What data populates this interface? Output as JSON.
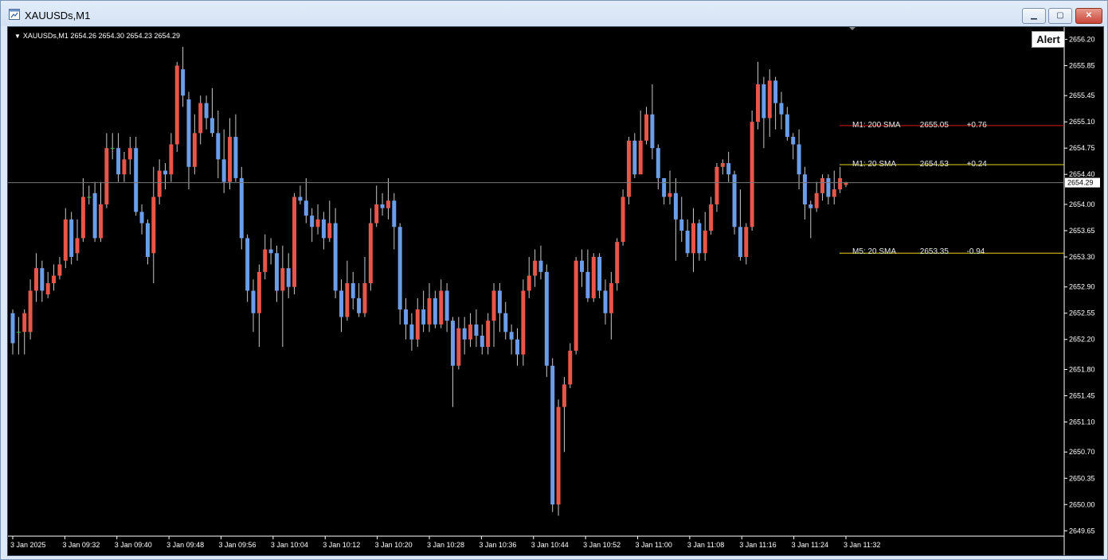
{
  "window": {
    "title": "XAUUSDs,M1",
    "buttons": {
      "minimize": "▁",
      "maximize": "▢",
      "close": "✕"
    }
  },
  "chart": {
    "header": "XAUUSDs,M1  2654.26 2654.30 2654.23 2654.29",
    "alert_label": "Alert",
    "current_price": "2654.29",
    "colors": {
      "background": "#000000",
      "bull": "#e8564a",
      "bear": "#6b9de8",
      "neutral": "#3cc33c",
      "axis_text": "#ffffff",
      "grid_line": "#7a7a7a",
      "sma_m1_200": "#d01c1c",
      "sma_m1_20": "#e3d51e",
      "sma_m5_20": "#e3d51e"
    },
    "sma_lines": [
      {
        "name": "M1: 200  SMA",
        "value": "2655.05",
        "diff": "+0.76",
        "price": 2655.05,
        "color": "#d01c1c"
      },
      {
        "name": "M1: 20  SMA",
        "value": "2654.53",
        "diff": "+0.24",
        "price": 2654.53,
        "color": "#e3d51e"
      },
      {
        "name": "M5: 20  SMA",
        "value": "2653.35",
        "diff": "-0.94",
        "price": 2653.35,
        "color": "#e3d51e"
      }
    ]
  },
  "chart_data": {
    "type": "candlestick",
    "y_ticks": [
      "2656.20",
      "2655.85",
      "2655.45",
      "2655.10",
      "2654.75",
      "2654.40",
      "2654.00",
      "2653.65",
      "2653.30",
      "2652.90",
      "2652.55",
      "2652.20",
      "2651.80",
      "2651.45",
      "2651.10",
      "2650.70",
      "2650.35",
      "2650.00",
      "2649.65"
    ],
    "x_ticks": [
      "3 Jan 2025",
      "3 Jan 09:32",
      "3 Jan 09:40",
      "3 Jan 09:48",
      "3 Jan 09:56",
      "3 Jan 10:04",
      "3 Jan 10:12",
      "3 Jan 10:20",
      "3 Jan 10:28",
      "3 Jan 10:36",
      "3 Jan 10:44",
      "3 Jan 10:52",
      "3 Jan 11:00",
      "3 Jan 11:08",
      "3 Jan 11:16",
      "3 Jan 11:24",
      "3 Jan 11:32"
    ],
    "ylim": [
      2649.6,
      2656.3
    ],
    "candles": [
      [
        2652.55,
        2652.15,
        2652.6,
        2652.0
      ],
      [
        2652.3,
        2652.3,
        2652.5,
        2652.0
      ],
      [
        2652.3,
        2652.55,
        2652.6,
        2652.0
      ],
      [
        2652.3,
        2652.85,
        2653.0,
        2652.2
      ],
      [
        2652.85,
        2653.15,
        2653.35,
        2652.7
      ],
      [
        2653.15,
        2652.85,
        2653.25,
        2652.7
      ],
      [
        2652.8,
        2652.95,
        2653.1,
        2652.75
      ],
      [
        2652.95,
        2653.05,
        2653.2,
        2652.85
      ],
      [
        2653.05,
        2653.2,
        2653.3,
        2653.0
      ],
      [
        2653.25,
        2653.8,
        2653.95,
        2653.15
      ],
      [
        2653.8,
        2653.3,
        2653.9,
        2653.2
      ],
      [
        2653.35,
        2653.55,
        2653.8,
        2653.25
      ],
      [
        2653.55,
        2654.1,
        2654.35,
        2653.5
      ],
      [
        2654.1,
        2654.1,
        2654.25,
        2654.0
      ],
      [
        2654.15,
        2653.55,
        2654.3,
        2653.5
      ],
      [
        2653.55,
        2654.0,
        2654.3,
        2653.5
      ],
      [
        2654.0,
        2654.75,
        2654.95,
        2653.95
      ],
      [
        2654.75,
        2654.75,
        2654.95,
        2654.6
      ],
      [
        2654.75,
        2654.4,
        2654.95,
        2654.3
      ],
      [
        2654.4,
        2654.6,
        2654.7,
        2654.3
      ],
      [
        2654.6,
        2654.75,
        2654.9,
        2654.4
      ],
      [
        2654.75,
        2653.9,
        2654.9,
        2653.85
      ],
      [
        2653.9,
        2653.75,
        2654.0,
        2653.6
      ],
      [
        2653.75,
        2653.3,
        2653.8,
        2653.2
      ],
      [
        2653.35,
        2654.1,
        2654.5,
        2652.95
      ],
      [
        2654.1,
        2654.45,
        2654.6,
        2654.0
      ],
      [
        2654.45,
        2654.4,
        2654.55,
        2654.2
      ],
      [
        2654.4,
        2654.8,
        2654.95,
        2654.3
      ],
      [
        2654.8,
        2655.85,
        2655.9,
        2654.7
      ],
      [
        2655.8,
        2655.45,
        2656.1,
        2655.3
      ],
      [
        2655.4,
        2654.5,
        2655.5,
        2654.2
      ],
      [
        2654.5,
        2654.95,
        2655.2,
        2654.4
      ],
      [
        2654.95,
        2655.35,
        2655.45,
        2654.8
      ],
      [
        2655.35,
        2655.15,
        2655.45,
        2655.0
      ],
      [
        2655.15,
        2654.95,
        2655.55,
        2654.9
      ],
      [
        2654.95,
        2654.6,
        2655.25,
        2654.35
      ],
      [
        2654.6,
        2654.3,
        2655.0,
        2654.15
      ],
      [
        2654.3,
        2654.9,
        2655.15,
        2654.2
      ],
      [
        2654.9,
        2654.35,
        2655.2,
        2654.3
      ],
      [
        2654.35,
        2653.55,
        2654.5,
        2653.4
      ],
      [
        2653.55,
        2652.85,
        2653.6,
        2652.7
      ],
      [
        2652.85,
        2652.55,
        2653.0,
        2652.3
      ],
      [
        2652.55,
        2653.1,
        2653.2,
        2652.1
      ],
      [
        2653.1,
        2653.4,
        2653.6,
        2653.0
      ],
      [
        2653.4,
        2653.35,
        2653.55,
        2653.2
      ],
      [
        2653.35,
        2652.85,
        2653.45,
        2652.7
      ],
      [
        2652.85,
        2653.15,
        2653.45,
        2652.1
      ],
      [
        2653.15,
        2652.9,
        2653.35,
        2652.75
      ],
      [
        2652.9,
        2654.1,
        2654.15,
        2652.8
      ],
      [
        2654.1,
        2654.05,
        2654.25,
        2654.0
      ],
      [
        2654.05,
        2653.85,
        2654.35,
        2653.75
      ],
      [
        2653.85,
        2653.7,
        2653.95,
        2653.5
      ],
      [
        2653.7,
        2653.8,
        2654.0,
        2653.6
      ],
      [
        2653.8,
        2653.55,
        2653.9,
        2653.4
      ],
      [
        2653.55,
        2653.75,
        2654.05,
        2653.5
      ],
      [
        2653.75,
        2652.85,
        2653.95,
        2652.75
      ],
      [
        2652.85,
        2652.5,
        2653.0,
        2652.3
      ],
      [
        2652.5,
        2652.95,
        2653.25,
        2652.45
      ],
      [
        2652.95,
        2652.75,
        2653.1,
        2652.6
      ],
      [
        2652.75,
        2652.55,
        2652.95,
        2652.5
      ],
      [
        2652.55,
        2652.95,
        2653.3,
        2652.5
      ],
      [
        2652.95,
        2653.75,
        2653.95,
        2652.85
      ],
      [
        2653.75,
        2654.0,
        2654.25,
        2653.7
      ],
      [
        2654.0,
        2653.95,
        2654.15,
        2653.85
      ],
      [
        2653.95,
        2654.05,
        2654.35,
        2653.8
      ],
      [
        2654.05,
        2653.7,
        2654.15,
        2653.4
      ],
      [
        2653.7,
        2652.6,
        2653.75,
        2652.4
      ],
      [
        2652.6,
        2652.4,
        2652.75,
        2652.2
      ],
      [
        2652.4,
        2652.2,
        2652.55,
        2652.05
      ],
      [
        2652.2,
        2652.6,
        2652.75,
        2652.1
      ],
      [
        2652.6,
        2652.4,
        2652.85,
        2652.3
      ],
      [
        2652.4,
        2652.75,
        2652.95,
        2652.3
      ],
      [
        2652.75,
        2652.4,
        2652.85,
        2652.35
      ],
      [
        2652.4,
        2652.85,
        2653.0,
        2652.35
      ],
      [
        2652.85,
        2652.45,
        2652.95,
        2652.3
      ],
      [
        2652.45,
        2651.85,
        2652.5,
        2651.3
      ],
      [
        2651.85,
        2652.35,
        2652.5,
        2651.8
      ],
      [
        2652.35,
        2652.2,
        2652.5,
        2652.0
      ],
      [
        2652.2,
        2652.4,
        2652.55,
        2652.1
      ],
      [
        2652.4,
        2652.25,
        2652.6,
        2652.1
      ],
      [
        2652.25,
        2652.1,
        2652.4,
        2652.0
      ],
      [
        2652.1,
        2652.45,
        2652.55,
        2652.0
      ],
      [
        2652.45,
        2652.85,
        2652.95,
        2652.1
      ],
      [
        2652.85,
        2652.55,
        2652.95,
        2652.3
      ],
      [
        2652.55,
        2652.3,
        2652.7,
        2652.2
      ],
      [
        2652.3,
        2652.2,
        2652.4,
        2652.0
      ],
      [
        2652.2,
        2652.0,
        2652.35,
        2651.85
      ],
      [
        2652.0,
        2652.85,
        2653.0,
        2651.85
      ],
      [
        2652.85,
        2653.05,
        2653.3,
        2652.75
      ],
      [
        2653.05,
        2653.25,
        2653.4,
        2652.9
      ],
      [
        2653.25,
        2653.1,
        2653.45,
        2653.0
      ],
      [
        2653.1,
        2651.85,
        2653.2,
        2651.7
      ],
      [
        2651.85,
        2650.0,
        2651.95,
        2649.9
      ],
      [
        2650.0,
        2651.3,
        2651.4,
        2649.85
      ],
      [
        2651.3,
        2651.6,
        2651.7,
        2650.7
      ],
      [
        2651.6,
        2652.05,
        2652.15,
        2651.55
      ],
      [
        2652.05,
        2653.25,
        2653.3,
        2652.0
      ],
      [
        2653.25,
        2653.1,
        2653.4,
        2652.9
      ],
      [
        2653.1,
        2652.75,
        2653.4,
        2652.7
      ],
      [
        2652.75,
        2653.3,
        2653.35,
        2652.7
      ],
      [
        2653.3,
        2652.85,
        2653.35,
        2652.75
      ],
      [
        2652.85,
        2652.55,
        2653.0,
        2652.4
      ],
      [
        2652.55,
        2652.95,
        2653.1,
        2652.2
      ],
      [
        2652.95,
        2653.5,
        2653.55,
        2652.85
      ],
      [
        2653.5,
        2654.1,
        2654.2,
        2653.45
      ],
      [
        2654.1,
        2654.85,
        2654.9,
        2654.0
      ],
      [
        2654.85,
        2654.4,
        2654.95,
        2654.35
      ],
      [
        2654.4,
        2654.85,
        2655.25,
        2654.7
      ],
      [
        2654.85,
        2655.2,
        2655.3,
        2654.8
      ],
      [
        2655.2,
        2654.75,
        2655.6,
        2654.6
      ],
      [
        2654.75,
        2654.35,
        2654.8,
        2654.2
      ],
      [
        2654.35,
        2654.1,
        2654.3,
        2654.0
      ],
      [
        2654.1,
        2654.15,
        2654.45,
        2654.0
      ],
      [
        2654.15,
        2653.8,
        2654.35,
        2653.25
      ],
      [
        2653.8,
        2653.65,
        2654.1,
        2653.5
      ],
      [
        2653.65,
        2653.35,
        2653.8,
        2653.3
      ],
      [
        2653.35,
        2653.75,
        2653.95,
        2653.1
      ],
      [
        2653.75,
        2653.35,
        2653.8,
        2653.25
      ],
      [
        2653.35,
        2653.65,
        2653.9,
        2653.25
      ],
      [
        2653.65,
        2654.0,
        2654.1,
        2653.6
      ],
      [
        2654.0,
        2654.5,
        2654.55,
        2653.9
      ],
      [
        2654.5,
        2654.55,
        2654.6,
        2654.4
      ],
      [
        2654.55,
        2654.4,
        2654.7,
        2654.3
      ],
      [
        2654.4,
        2653.7,
        2654.45,
        2653.6
      ],
      [
        2653.7,
        2653.3,
        2654.2,
        2653.25
      ],
      [
        2653.3,
        2653.7,
        2653.75,
        2653.2
      ],
      [
        2653.7,
        2655.1,
        2655.25,
        2653.65
      ],
      [
        2655.1,
        2655.6,
        2655.9,
        2655.0
      ],
      [
        2655.6,
        2655.15,
        2655.7,
        2654.75
      ],
      [
        2655.15,
        2655.65,
        2655.8,
        2654.9
      ],
      [
        2655.65,
        2655.35,
        2655.7,
        2655.0
      ],
      [
        2655.35,
        2655.2,
        2655.5,
        2655.0
      ],
      [
        2655.2,
        2654.9,
        2655.3,
        2654.85
      ],
      [
        2654.9,
        2654.8,
        2654.95,
        2654.6
      ],
      [
        2654.8,
        2654.4,
        2655.0,
        2654.2
      ],
      [
        2654.4,
        2654.0,
        2654.5,
        2653.8
      ],
      [
        2654.0,
        2653.95,
        2654.05,
        2653.55
      ],
      [
        2653.95,
        2654.15,
        2654.3,
        2653.9
      ],
      [
        2654.15,
        2654.35,
        2654.4,
        2654.05
      ],
      [
        2654.35,
        2654.1,
        2654.4,
        2654.0
      ],
      [
        2654.1,
        2654.2,
        2654.45,
        2654.0
      ],
      [
        2654.2,
        2654.35,
        2654.5,
        2654.15
      ],
      [
        2654.26,
        2654.29,
        2654.3,
        2654.23
      ]
    ]
  }
}
